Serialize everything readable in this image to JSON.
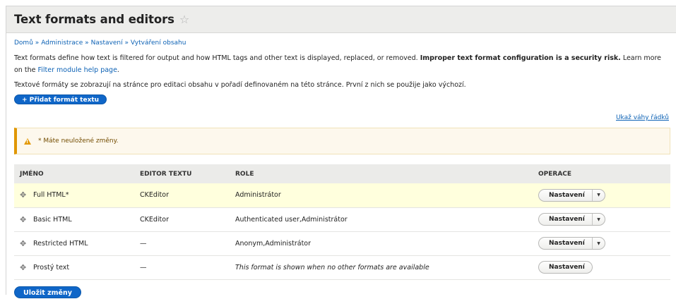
{
  "header": {
    "title": "Text formats and editors",
    "star_icon": "star-outline-icon"
  },
  "breadcrumb": [
    "Domů",
    "Administrace",
    "Nastavení",
    "Vytváření obsahu"
  ],
  "breadcrumb_sep": "»",
  "help": {
    "text_before": "Text formats define how text is filtered for output and how HTML tags and other text is displayed, replaced, or removed. ",
    "bold": "Improper text format configuration is a security risk.",
    "text_after": " Learn more on the ",
    "link": "Filter module help page",
    "end": "."
  },
  "order_note": "Textové formáty se zobrazují na stránce pro editaci obsahu v pořadí definovaném na této stránce. První z nich se použije jako výchozí.",
  "add_button": "+ Přidat formát textu",
  "row_weights_link": "Ukaž váhy řádků",
  "warning": {
    "icon": "warning-triangle-icon",
    "text": "* Máte neuložené změny."
  },
  "table": {
    "headers": [
      "Jméno",
      "Editor textu",
      "Role",
      "Operace"
    ],
    "rows": [
      {
        "name": "Full HTML*",
        "editor": "CKEditor",
        "roles": "Administrátor",
        "op": "Nastavení",
        "has_toggle": true,
        "highlighted": true,
        "roles_italic": false
      },
      {
        "name": "Basic HTML",
        "editor": "CKEditor",
        "roles": "Authenticated user,Administrátor",
        "op": "Nastavení",
        "has_toggle": true,
        "highlighted": false,
        "roles_italic": false
      },
      {
        "name": "Restricted HTML",
        "editor": "—",
        "roles": "Anonym,Administrátor",
        "op": "Nastavení",
        "has_toggle": true,
        "highlighted": false,
        "roles_italic": false
      },
      {
        "name": "Prostý text",
        "editor": "—",
        "roles": "This format is shown when no other formats are available",
        "op": "Nastavení",
        "has_toggle": false,
        "highlighted": false,
        "roles_italic": true
      }
    ]
  },
  "save_button": "Uložit změny",
  "colors": {
    "accent": "#0f66c8",
    "link": "#0d62b5",
    "warning_border": "#e09600",
    "row_highlight": "#ffffdd"
  }
}
